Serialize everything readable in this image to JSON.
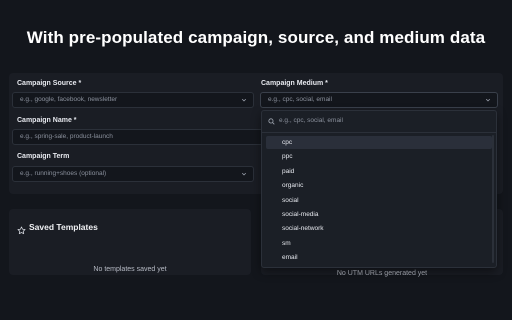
{
  "headline": "With pre-populated campaign, source, and medium data",
  "form": {
    "source_label": "Campaign Source *",
    "source_placeholder": "e.g., google, facebook, newsletter",
    "medium_label": "Campaign Medium *",
    "medium_placeholder": "e.g., cpc, social, email",
    "name_label": "Campaign Name *",
    "name_placeholder": "e.g., spring-sale, product-launch",
    "term_label": "Campaign Term",
    "term_placeholder": "e.g., running+shoes (optional)"
  },
  "dropdown": {
    "search_placeholder": "e.g., cpc, social, email",
    "options": [
      "cpc",
      "ppc",
      "paid",
      "organic",
      "social",
      "social-media",
      "social-network",
      "sm",
      "email"
    ],
    "selected_index": 0
  },
  "saved_templates": {
    "title": "Saved Templates",
    "empty_text": "No templates saved yet"
  },
  "generated_urls": {
    "empty_text": "No UTM URLs generated yet"
  },
  "icons": {
    "templates": "star-icon",
    "search": "search-icon",
    "dropdown": "chevron-down-icon"
  }
}
